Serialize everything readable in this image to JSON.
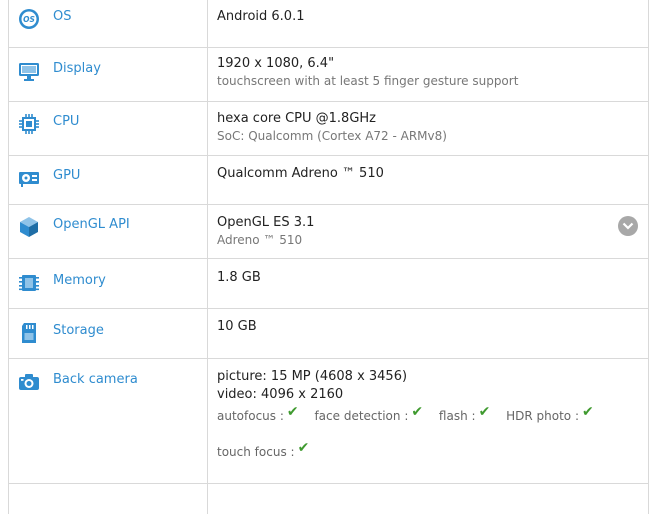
{
  "specs": {
    "os": {
      "label": "OS",
      "value": "Android 6.0.1",
      "icon": "os-icon"
    },
    "display": {
      "label": "Display",
      "value": "1920 x 1080, 6.4\"",
      "sub": "touchscreen with at least 5 finger gesture support",
      "icon": "monitor-icon"
    },
    "cpu": {
      "label": "CPU",
      "value": "hexa core CPU @1.8GHz",
      "sub": "SoC: Qualcomm (Cortex A72 - ARMv8)",
      "icon": "cpu-icon"
    },
    "gpu": {
      "label": "GPU",
      "value": "Qualcomm Adreno ™ 510",
      "icon": "gpu-icon"
    },
    "opengl": {
      "label": "OpenGL API",
      "value": "OpenGL ES 3.1",
      "sub": "Adreno ™ 510",
      "icon": "cube-icon"
    },
    "memory": {
      "label": "Memory",
      "value": "1.8 GB",
      "icon": "memory-chip-icon"
    },
    "storage": {
      "label": "Storage",
      "value": "10 GB",
      "icon": "sd-card-icon"
    },
    "back_camera": {
      "label": "Back camera",
      "picture": "picture: 15 MP (4608 x 3456)",
      "video": "video: 4096 x 2160",
      "icon": "camera-icon",
      "features": [
        "autofocus :",
        "face detection :",
        "flash :",
        "HDR photo :"
      ],
      "features2": [
        "touch focus :"
      ],
      "check_glyph": "✔"
    }
  },
  "colors": {
    "accent": "#2f8ccf",
    "check": "#3f9a2f",
    "border": "#d9d9d9"
  }
}
